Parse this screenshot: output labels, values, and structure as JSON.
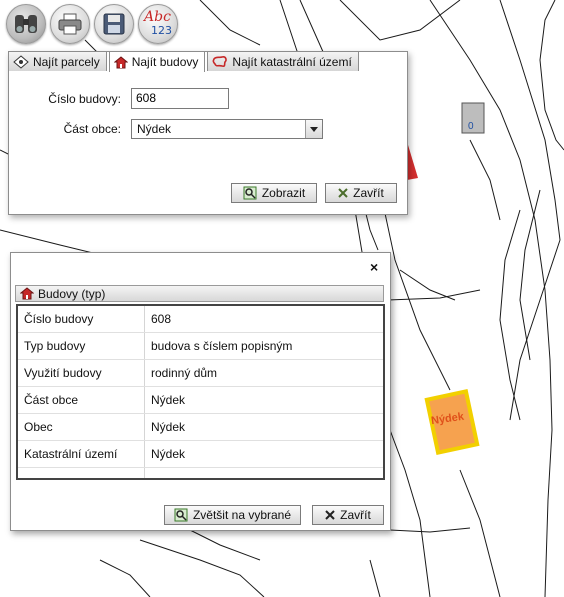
{
  "toolbar": {
    "buttons": [
      {
        "name": "binoculars-icon",
        "active": true
      },
      {
        "name": "printer-icon",
        "active": false
      },
      {
        "name": "floppy-save-icon",
        "active": false
      },
      {
        "name": "abc-123-icon",
        "abc": "Abc",
        "num": "123"
      }
    ]
  },
  "map": {
    "parcel_label": "0",
    "highlight_label": "Nýdek",
    "highlight_color": "#f6a24f",
    "highlight_border": "#f2d000"
  },
  "search_panel": {
    "tabs": [
      {
        "label": "Najít parcely",
        "icon": "parcel-icon",
        "active": false
      },
      {
        "label": "Najít budovy",
        "icon": "house-icon",
        "active": true
      },
      {
        "label": "Najít katastrální území",
        "icon": "area-icon",
        "active": false
      }
    ],
    "cislo_budovy_label": "Číslo budovy:",
    "cislo_budovy_value": "608",
    "cast_obce_label": "Část obce:",
    "cast_obce_value": "Nýdek",
    "show_button": "Zobrazit",
    "close_button": "Zavřít"
  },
  "results_panel": {
    "close_glyph": "×",
    "header": "Budovy (typ)",
    "rows": [
      {
        "key": "Číslo budovy",
        "value": "608"
      },
      {
        "key": "Typ budovy",
        "value": "budova s číslem popisným"
      },
      {
        "key": "Využití budovy",
        "value": "rodinný dům"
      },
      {
        "key": "Část obce",
        "value": "Nýdek"
      },
      {
        "key": "Obec",
        "value": "Nýdek"
      },
      {
        "key": "Katastrální území",
        "value": "Nýdek"
      },
      {
        "key": "",
        "value": ""
      }
    ],
    "zoom_button": "Zvětšit na vybrané",
    "close_button": "Zavřít"
  }
}
